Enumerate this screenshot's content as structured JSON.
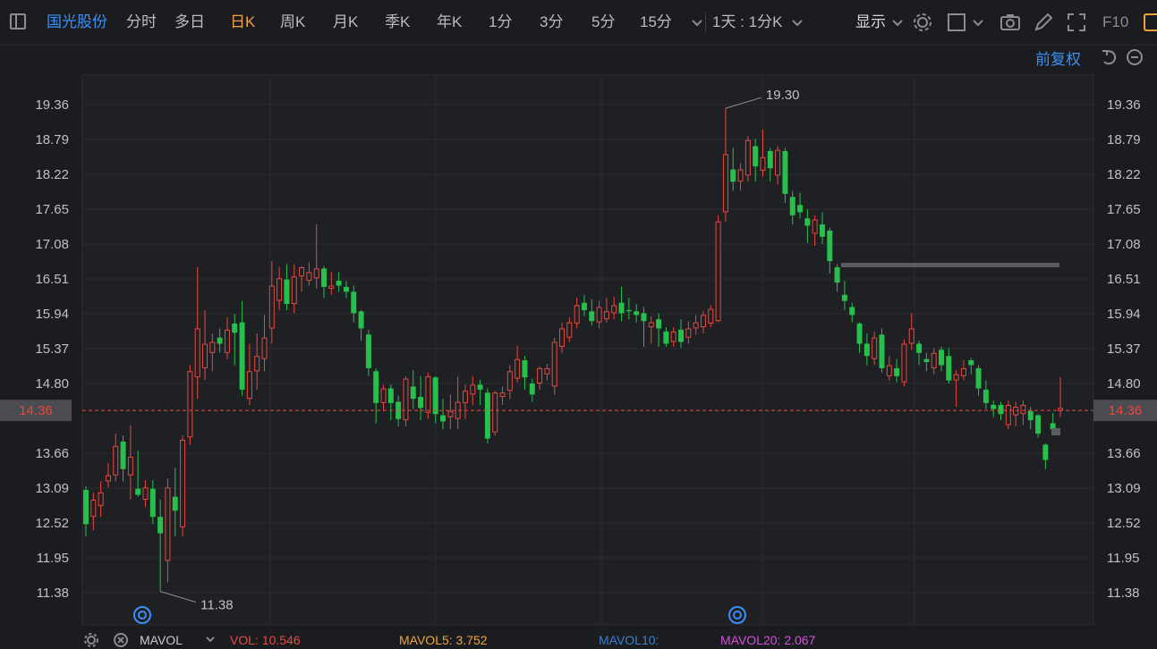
{
  "toolbar": {
    "stock_name": "国光股份",
    "periods": [
      "分时",
      "多日",
      "日K",
      "周K",
      "月K",
      "季K",
      "年K",
      "1分",
      "3分",
      "5分",
      "15分"
    ],
    "active_period": "日K",
    "interval_select": "1天 : 1分K",
    "display_label": "显示",
    "f10_label": "F10",
    "icons": [
      "sidebar-toggle-icon",
      "chevron-down-icon",
      "settings-gear-icon",
      "square-checkbox-icon",
      "camera-icon",
      "pencil-icon",
      "fullscreen-icon"
    ]
  },
  "chart_header": {
    "adjust_label": "前复权",
    "icons": [
      "undo-icon",
      "minus-circle-icon"
    ]
  },
  "legend": {
    "mavol_label": "MAVOL",
    "vol": "VOL: 10.546",
    "mavol5": "MAVOL5: 3.752",
    "mavol10": "MAVOL10:",
    "mavol20": "MAVOL20: 2.067",
    "icons": [
      "settings-gear-icon",
      "close-icon",
      "chevron-down-icon"
    ]
  },
  "colors": {
    "background": "#1b1c20",
    "up": "#e8483e",
    "down": "#27c04c",
    "grid": "#2b2d33",
    "axis_text": "#bfc1c5",
    "current_price_line": "#e8483e",
    "active_tab": "#f0a33c",
    "link_blue": "#3b8ff5",
    "vol_color": "#e8483e",
    "mavol5_color": "#f0a33c",
    "mavol10_color": "#3b7fd0",
    "mavol20_color": "#d34fd8"
  },
  "chart_data": {
    "type": "candlestick",
    "yticks": [
      19.36,
      18.79,
      18.22,
      17.65,
      17.08,
      16.51,
      15.94,
      15.37,
      14.8,
      13.66,
      13.09,
      12.52,
      11.95,
      11.38
    ],
    "ylim": [
      11.38,
      19.36
    ],
    "current_price": 14.36,
    "current_price_label": "14.36",
    "high_annotation": "19.30",
    "low_annotation": "11.38",
    "candles": [
      {
        "o": 13.06,
        "c": 12.5,
        "h": 13.12,
        "l": 12.3
      },
      {
        "o": 12.62,
        "c": 12.9,
        "h": 13.02,
        "l": 12.4
      },
      {
        "o": 12.8,
        "c": 13.02,
        "h": 13.2,
        "l": 12.62
      },
      {
        "o": 13.2,
        "c": 13.3,
        "h": 13.5,
        "l": 13.1
      },
      {
        "o": 13.3,
        "c": 13.78,
        "h": 13.98,
        "l": 13.2
      },
      {
        "o": 13.85,
        "c": 13.4,
        "h": 13.95,
        "l": 13.2
      },
      {
        "o": 13.3,
        "c": 13.6,
        "h": 14.12,
        "l": 12.9
      },
      {
        "o": 13.08,
        "c": 12.98,
        "h": 13.7,
        "l": 12.95
      },
      {
        "o": 12.9,
        "c": 13.1,
        "h": 13.22,
        "l": 12.78
      },
      {
        "o": 13.08,
        "c": 12.62,
        "h": 13.22,
        "l": 12.5
      },
      {
        "o": 12.62,
        "c": 12.35,
        "h": 12.9,
        "l": 11.4
      },
      {
        "o": 11.9,
        "c": 13.1,
        "h": 13.25,
        "l": 11.55
      },
      {
        "o": 12.95,
        "c": 12.72,
        "h": 13.42,
        "l": 12.3
      },
      {
        "o": 12.45,
        "c": 13.88,
        "h": 13.95,
        "l": 12.3
      },
      {
        "o": 13.92,
        "c": 15.0,
        "h": 15.1,
        "l": 13.8
      },
      {
        "o": 14.9,
        "c": 15.7,
        "h": 16.7,
        "l": 14.55
      },
      {
        "o": 15.05,
        "c": 15.45,
        "h": 16.0,
        "l": 14.86
      },
      {
        "o": 15.3,
        "c": 15.48,
        "h": 15.62,
        "l": 15.0
      },
      {
        "o": 15.55,
        "c": 15.45,
        "h": 15.7,
        "l": 15.3
      },
      {
        "o": 15.3,
        "c": 15.68,
        "h": 15.88,
        "l": 15.2
      },
      {
        "o": 15.78,
        "c": 15.63,
        "h": 15.94,
        "l": 15.1
      },
      {
        "o": 15.8,
        "c": 14.7,
        "h": 16.15,
        "l": 14.6
      },
      {
        "o": 14.55,
        "c": 15.0,
        "h": 15.45,
        "l": 14.45
      },
      {
        "o": 15.0,
        "c": 15.25,
        "h": 15.62,
        "l": 14.7
      },
      {
        "o": 15.2,
        "c": 15.55,
        "h": 15.92,
        "l": 15.0
      },
      {
        "o": 15.7,
        "c": 16.4,
        "h": 16.8,
        "l": 15.45
      },
      {
        "o": 16.15,
        "c": 16.52,
        "h": 16.7,
        "l": 16.0
      },
      {
        "o": 16.5,
        "c": 16.1,
        "h": 16.75,
        "l": 16.0
      },
      {
        "o": 16.1,
        "c": 16.55,
        "h": 16.75,
        "l": 15.95
      },
      {
        "o": 16.55,
        "c": 16.7,
        "h": 16.72,
        "l": 16.3
      },
      {
        "o": 16.48,
        "c": 16.62,
        "h": 16.78,
        "l": 16.4
      },
      {
        "o": 16.52,
        "c": 16.68,
        "h": 17.4,
        "l": 16.35
      },
      {
        "o": 16.68,
        "c": 16.38,
        "h": 16.72,
        "l": 16.2
      },
      {
        "o": 16.35,
        "c": 16.4,
        "h": 16.62,
        "l": 16.25
      },
      {
        "o": 16.48,
        "c": 16.4,
        "h": 16.62,
        "l": 16.3
      },
      {
        "o": 16.38,
        "c": 16.3,
        "h": 16.48,
        "l": 16.2
      },
      {
        "o": 16.3,
        "c": 15.95,
        "h": 16.4,
        "l": 15.8
      },
      {
        "o": 15.98,
        "c": 15.7,
        "h": 16.0,
        "l": 15.5
      },
      {
        "o": 15.6,
        "c": 15.05,
        "h": 15.68,
        "l": 14.92
      },
      {
        "o": 15.0,
        "c": 14.48,
        "h": 15.05,
        "l": 14.15
      },
      {
        "o": 14.48,
        "c": 14.72,
        "h": 14.78,
        "l": 14.35
      },
      {
        "o": 14.72,
        "c": 14.48,
        "h": 14.78,
        "l": 14.2
      },
      {
        "o": 14.5,
        "c": 14.22,
        "h": 14.6,
        "l": 14.1
      },
      {
        "o": 14.2,
        "c": 14.88,
        "h": 14.92,
        "l": 14.1
      },
      {
        "o": 14.75,
        "c": 14.55,
        "h": 15.02,
        "l": 14.38
      },
      {
        "o": 14.58,
        "c": 14.4,
        "h": 14.92,
        "l": 14.2
      },
      {
        "o": 14.32,
        "c": 14.92,
        "h": 14.98,
        "l": 14.22
      },
      {
        "o": 14.9,
        "c": 14.3,
        "h": 14.92,
        "l": 14.15
      },
      {
        "o": 14.28,
        "c": 14.18,
        "h": 14.55,
        "l": 14.05
      },
      {
        "o": 14.25,
        "c": 14.35,
        "h": 14.62,
        "l": 14.05
      },
      {
        "o": 14.22,
        "c": 14.5,
        "h": 14.92,
        "l": 14.05
      },
      {
        "o": 14.48,
        "c": 14.68,
        "h": 14.78,
        "l": 14.22
      },
      {
        "o": 14.62,
        "c": 14.78,
        "h": 14.92,
        "l": 14.45
      },
      {
        "o": 14.78,
        "c": 14.7,
        "h": 14.86,
        "l": 14.45
      },
      {
        "o": 14.65,
        "c": 13.9,
        "h": 14.72,
        "l": 13.82
      },
      {
        "o": 14.0,
        "c": 14.65,
        "h": 14.68,
        "l": 13.95
      },
      {
        "o": 14.58,
        "c": 14.65,
        "h": 14.75,
        "l": 14.45
      },
      {
        "o": 14.68,
        "c": 15.0,
        "h": 15.1,
        "l": 14.55
      },
      {
        "o": 14.88,
        "c": 15.2,
        "h": 15.42,
        "l": 14.82
      },
      {
        "o": 15.18,
        "c": 14.9,
        "h": 15.25,
        "l": 14.7
      },
      {
        "o": 14.8,
        "c": 14.62,
        "h": 14.88,
        "l": 14.5
      },
      {
        "o": 14.8,
        "c": 15.05,
        "h": 15.08,
        "l": 14.7
      },
      {
        "o": 14.95,
        "c": 15.05,
        "h": 15.12,
        "l": 14.85
      },
      {
        "o": 14.75,
        "c": 15.48,
        "h": 15.55,
        "l": 14.62
      },
      {
        "o": 15.4,
        "c": 15.7,
        "h": 15.8,
        "l": 15.3
      },
      {
        "o": 15.55,
        "c": 15.8,
        "h": 15.88,
        "l": 15.48
      },
      {
        "o": 15.78,
        "c": 16.08,
        "h": 16.2,
        "l": 15.7
      },
      {
        "o": 16.12,
        "c": 16.0,
        "h": 16.25,
        "l": 15.9
      },
      {
        "o": 15.98,
        "c": 15.82,
        "h": 16.18,
        "l": 15.75
      },
      {
        "o": 15.8,
        "c": 16.05,
        "h": 16.15,
        "l": 15.7
      },
      {
        "o": 15.85,
        "c": 15.98,
        "h": 16.2,
        "l": 15.8
      },
      {
        "o": 15.95,
        "c": 16.08,
        "h": 16.22,
        "l": 15.85
      },
      {
        "o": 16.12,
        "c": 15.95,
        "h": 16.38,
        "l": 15.82
      },
      {
        "o": 16.0,
        "c": 15.98,
        "h": 16.2,
        "l": 15.85
      },
      {
        "o": 15.98,
        "c": 15.92,
        "h": 16.1,
        "l": 15.8
      },
      {
        "o": 15.95,
        "c": 15.82,
        "h": 16.05,
        "l": 15.4
      },
      {
        "o": 15.72,
        "c": 15.8,
        "h": 15.9,
        "l": 15.45
      },
      {
        "o": 15.85,
        "c": 15.7,
        "h": 15.95,
        "l": 15.4
      },
      {
        "o": 15.65,
        "c": 15.45,
        "h": 15.72,
        "l": 15.4
      },
      {
        "o": 15.48,
        "c": 15.65,
        "h": 15.72,
        "l": 15.4
      },
      {
        "o": 15.68,
        "c": 15.48,
        "h": 15.85,
        "l": 15.38
      },
      {
        "o": 15.55,
        "c": 15.7,
        "h": 15.82,
        "l": 15.45
      },
      {
        "o": 15.7,
        "c": 15.8,
        "h": 15.92,
        "l": 15.6
      },
      {
        "o": 15.72,
        "c": 15.92,
        "h": 15.98,
        "l": 15.62
      },
      {
        "o": 15.78,
        "c": 16.02,
        "h": 16.08,
        "l": 15.72
      },
      {
        "o": 15.82,
        "c": 17.45,
        "h": 17.55,
        "l": 15.8
      },
      {
        "o": 17.6,
        "c": 18.55,
        "h": 19.3,
        "l": 17.45
      },
      {
        "o": 18.3,
        "c": 18.1,
        "h": 18.65,
        "l": 17.95
      },
      {
        "o": 18.1,
        "c": 18.3,
        "h": 18.4,
        "l": 17.95
      },
      {
        "o": 18.2,
        "c": 18.78,
        "h": 18.85,
        "l": 18.1
      },
      {
        "o": 18.68,
        "c": 18.35,
        "h": 18.8,
        "l": 18.1
      },
      {
        "o": 18.28,
        "c": 18.5,
        "h": 18.95,
        "l": 18.18
      },
      {
        "o": 18.6,
        "c": 18.32,
        "h": 18.65,
        "l": 18.1
      },
      {
        "o": 18.2,
        "c": 18.62,
        "h": 18.68,
        "l": 18.05
      },
      {
        "o": 18.6,
        "c": 17.9,
        "h": 18.65,
        "l": 17.75
      },
      {
        "o": 17.85,
        "c": 17.55,
        "h": 17.95,
        "l": 17.4
      },
      {
        "o": 17.72,
        "c": 17.6,
        "h": 17.92,
        "l": 17.5
      },
      {
        "o": 17.5,
        "c": 17.38,
        "h": 17.65,
        "l": 17.1
      },
      {
        "o": 17.25,
        "c": 17.48,
        "h": 17.55,
        "l": 17.05
      },
      {
        "o": 17.4,
        "c": 17.2,
        "h": 17.6,
        "l": 17.08
      },
      {
        "o": 17.3,
        "c": 16.8,
        "h": 17.35,
        "l": 16.6
      },
      {
        "o": 16.7,
        "c": 16.45,
        "h": 16.75,
        "l": 16.3
      },
      {
        "o": 16.25,
        "c": 16.15,
        "h": 16.48,
        "l": 16.0
      },
      {
        "o": 16.05,
        "c": 15.92,
        "h": 16.12,
        "l": 15.8
      },
      {
        "o": 15.78,
        "c": 15.45,
        "h": 15.8,
        "l": 15.3
      },
      {
        "o": 15.45,
        "c": 15.25,
        "h": 15.62,
        "l": 15.1
      },
      {
        "o": 15.2,
        "c": 15.55,
        "h": 15.65,
        "l": 15.1
      },
      {
        "o": 15.6,
        "c": 15.05,
        "h": 15.7,
        "l": 14.98
      },
      {
        "o": 14.92,
        "c": 15.1,
        "h": 15.25,
        "l": 14.85
      },
      {
        "o": 15.05,
        "c": 14.92,
        "h": 15.2,
        "l": 14.82
      },
      {
        "o": 14.82,
        "c": 15.45,
        "h": 15.52,
        "l": 14.75
      },
      {
        "o": 15.45,
        "c": 15.7,
        "h": 15.95,
        "l": 15.35
      },
      {
        "o": 15.45,
        "c": 15.3,
        "h": 15.5,
        "l": 15.1
      },
      {
        "o": 15.2,
        "c": 15.15,
        "h": 15.3,
        "l": 15.0
      },
      {
        "o": 15.05,
        "c": 15.3,
        "h": 15.38,
        "l": 14.95
      },
      {
        "o": 15.35,
        "c": 15.1,
        "h": 15.4,
        "l": 15.0
      },
      {
        "o": 15.25,
        "c": 14.85,
        "h": 15.38,
        "l": 14.8
      },
      {
        "o": 14.85,
        "c": 14.95,
        "h": 15.02,
        "l": 14.42
      },
      {
        "o": 14.92,
        "c": 15.05,
        "h": 15.18,
        "l": 14.85
      },
      {
        "o": 15.18,
        "c": 15.1,
        "h": 15.22,
        "l": 14.95
      },
      {
        "o": 15.05,
        "c": 14.72,
        "h": 15.1,
        "l": 14.6
      },
      {
        "o": 14.7,
        "c": 14.48,
        "h": 14.85,
        "l": 14.38
      },
      {
        "o": 14.45,
        "c": 14.38,
        "h": 14.52,
        "l": 14.25
      },
      {
        "o": 14.45,
        "c": 14.3,
        "h": 14.5,
        "l": 14.2
      },
      {
        "o": 14.12,
        "c": 14.45,
        "h": 14.52,
        "l": 14.05
      },
      {
        "o": 14.28,
        "c": 14.42,
        "h": 14.5,
        "l": 14.1
      },
      {
        "o": 14.3,
        "c": 14.45,
        "h": 14.52,
        "l": 14.12
      },
      {
        "o": 14.35,
        "c": 14.2,
        "h": 14.42,
        "l": 14.05
      },
      {
        "o": 14.28,
        "c": 13.98,
        "h": 14.3,
        "l": 13.92
      },
      {
        "o": 13.8,
        "c": 13.55,
        "h": 13.82,
        "l": 13.4
      },
      {
        "o": 14.15,
        "c": 14.05,
        "h": 14.32,
        "l": 14.0
      },
      {
        "o": 14.35,
        "c": 14.4,
        "h": 14.9,
        "l": 14.25
      }
    ]
  }
}
